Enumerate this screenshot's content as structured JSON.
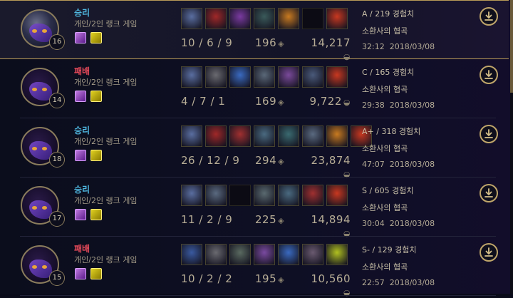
{
  "matches": [
    {
      "result": "승리",
      "result_type": "win",
      "mode": "개인/2인 랭크 게임",
      "level": "16",
      "kda": "10 / 6 / 9",
      "cs": "196",
      "gold": "14,217",
      "rank": "A / 219 경험치",
      "map": "소환사의 협곡",
      "time": "32:12",
      "date": "2018/03/08",
      "selected": true,
      "items": [
        {
          "color": "#5a6ea0"
        },
        {
          "color": "#a02828"
        },
        {
          "color": "#7a3aa0"
        },
        {
          "color": "#3a5a5a"
        },
        {
          "color": "#c87a20"
        },
        {
          "color": "#111018"
        },
        {
          "color": "#c83820"
        }
      ]
    },
    {
      "result": "패배",
      "result_type": "loss",
      "mode": "개인/2인 랭크 게임",
      "level": "14",
      "kda": "4 / 7 / 1",
      "cs": "169",
      "gold": "9,722",
      "rank": "C / 165 경험치",
      "map": "소환사의 협곡",
      "time": "29:38",
      "date": "2018/03/08",
      "selected": false,
      "items": [
        {
          "color": "#5a6ea0"
        },
        {
          "color": "#6a6a70"
        },
        {
          "color": "#3a6ac0"
        },
        {
          "color": "#5a6878"
        },
        {
          "color": "#7a4a9a"
        },
        {
          "color": "#4a5a7a"
        },
        {
          "color": "#c83820"
        }
      ]
    },
    {
      "result": "승리",
      "result_type": "win",
      "mode": "개인/2인 랭크 게임",
      "level": "18",
      "kda": "26 / 12 / 9",
      "cs": "294",
      "gold": "23,874",
      "rank": "A+ / 318 경험치",
      "map": "소환사의 협곡",
      "time": "47:07",
      "date": "2018/03/08",
      "selected": false,
      "items": [
        {
          "color": "#5a6ea0"
        },
        {
          "color": "#a02828"
        },
        {
          "color": "#a03030"
        },
        {
          "color": "#4a6a80"
        },
        {
          "color": "#3a6a70"
        },
        {
          "color": "#5a6a80"
        },
        {
          "color": "#c87a20"
        },
        {
          "color": "#c83820"
        }
      ]
    },
    {
      "result": "승리",
      "result_type": "win",
      "mode": "개인/2인 랭크 게임",
      "level": "17",
      "kda": "11 / 2 / 9",
      "cs": "225",
      "gold": "14,894",
      "rank": "S / 605 경험치",
      "map": "소환사의 협곡",
      "time": "30:04",
      "date": "2018/03/08",
      "selected": false,
      "items": [
        {
          "color": "#5a6ea0"
        },
        {
          "color": "#5a6a80"
        },
        {
          "color": "#111018"
        },
        {
          "color": "#5a6a70"
        },
        {
          "color": "#4a6a80"
        },
        {
          "color": "#a03030"
        },
        {
          "color": "#c83820"
        }
      ]
    },
    {
      "result": "패배",
      "result_type": "loss",
      "mode": "개인/2인 랭크 게임",
      "level": "15",
      "kda": "10 / 2 / 2",
      "cs": "195",
      "gold": "10,560",
      "rank": "S- / 129 경험치",
      "map": "소환사의 협곡",
      "time": "22:57",
      "date": "2018/03/08",
      "selected": false,
      "items": [
        {
          "color": "#3a5aa0"
        },
        {
          "color": "#6a6a70"
        },
        {
          "color": "#5a6a60"
        },
        {
          "color": "#7a4aa0"
        },
        {
          "color": "#3a6ac0"
        },
        {
          "color": "#6a5a70"
        },
        {
          "color": "#b0c020"
        }
      ]
    }
  ],
  "icons": {
    "cs": "minion-icon",
    "gold": "gold-coin-icon",
    "download": "download-icon"
  }
}
